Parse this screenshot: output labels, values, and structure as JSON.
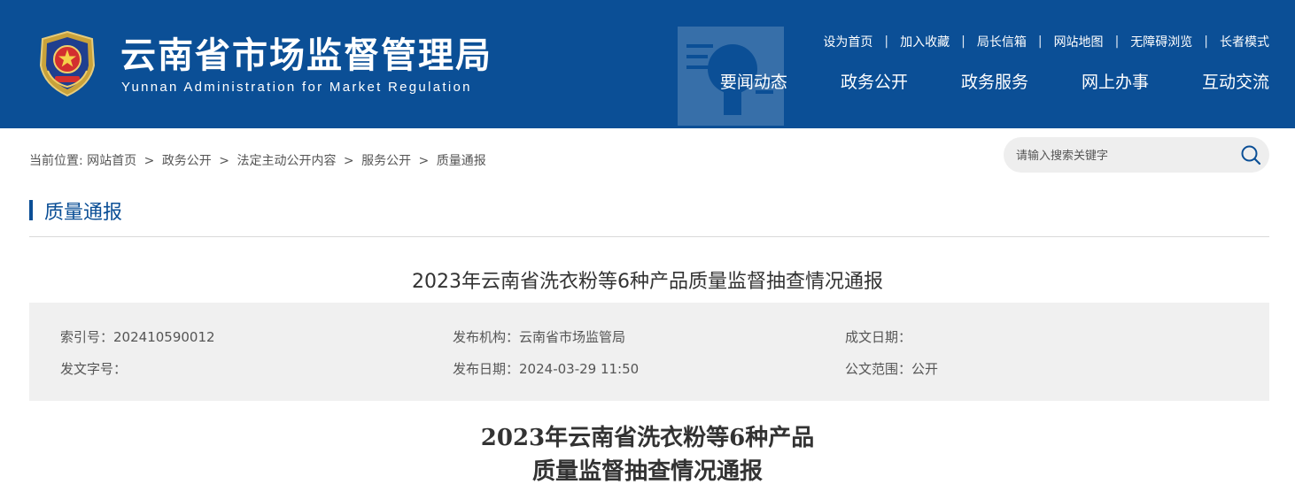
{
  "header": {
    "title": "云南省市场监督管理局",
    "subtitle": "Yunnan Administration for Market Regulation",
    "background_color": "#0b4f96",
    "top_links": [
      "设为首页",
      "加入收藏",
      "局长信箱",
      "网站地图",
      "无障碍浏览",
      "长者模式"
    ],
    "top_link_separator": "|",
    "nav": [
      "要闻动态",
      "政务公开",
      "政务服务",
      "网上办事",
      "互动交流"
    ]
  },
  "breadcrumb": {
    "prefix": "当前位置:",
    "items": [
      "网站首页",
      "政务公开",
      "法定主动公开内容",
      "服务公开",
      "质量通报"
    ],
    "separator": ">"
  },
  "search": {
    "placeholder": "请输入搜索关键字",
    "icon": "search-icon"
  },
  "section": {
    "title": "质量通报",
    "accent_color": "#0b4f96"
  },
  "article": {
    "title": "2023年云南省洗衣粉等6种产品质量监督抽查情况通报",
    "meta": {
      "index_label": "索引号：",
      "index_value": "202410590012",
      "publisher_label": "发布机构：",
      "publisher_value": "云南省市场监管局",
      "written_date_label": "成文日期：",
      "written_date_value": "",
      "doc_number_label": "发文字号：",
      "doc_number_value": "",
      "publish_date_label": "发布日期：",
      "publish_date_value": "2024-03-29 11:50",
      "scope_label": "公文范围：",
      "scope_value": "公开"
    },
    "doc_title_line1": "2023年云南省洗衣粉等6种产品",
    "doc_title_line2": "质量监督抽查情况通报"
  }
}
